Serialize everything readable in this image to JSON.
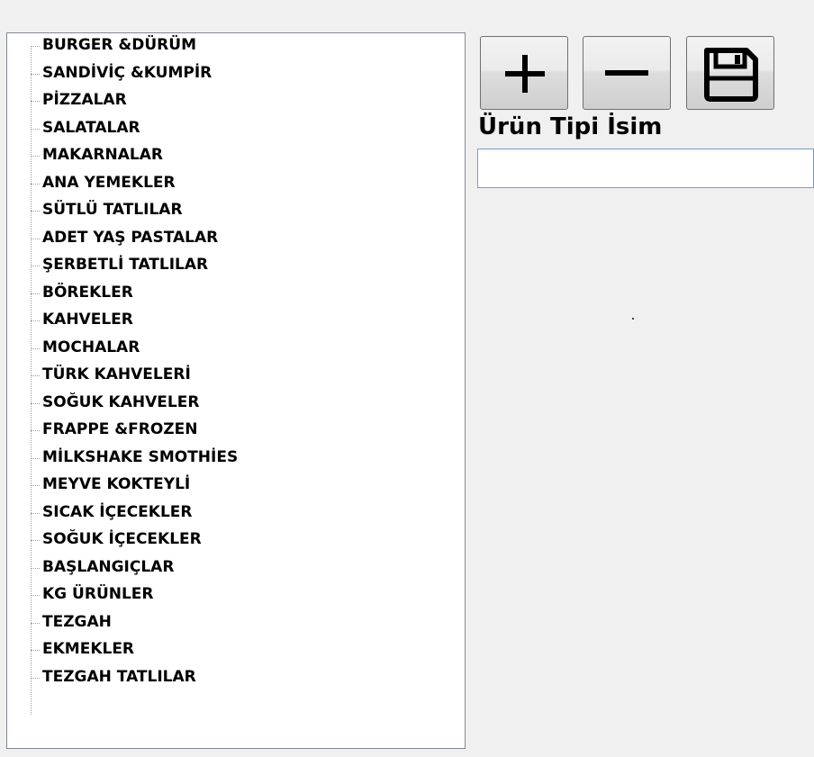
{
  "categories": {
    "items": [
      "BURGER &DÜRÜM",
      "SANDİVİÇ &KUMPİR",
      "PİZZALAR",
      "SALATALAR",
      "MAKARNALAR",
      "ANA YEMEKLER",
      "SÜTLÜ TATLILAR",
      "ADET YAŞ PASTALAR",
      "ŞERBETLİ TATLILAR",
      "BÖREKLER",
      "KAHVELER",
      "MOCHALAR",
      "TÜRK KAHVELERİ",
      "SOĞUK KAHVELER",
      "FRAPPE &FROZEN",
      "MİLKSHAKE SMOTHİES",
      "MEYVE KOKTEYLİ",
      "SICAK İÇECEKLER",
      "SOĞUK İÇECEKLER",
      "BAŞLANGIÇLAR",
      "KG ÜRÜNLER",
      "TEZGAH",
      "EKMEKLER",
      "TEZGAH TATLILAR"
    ]
  },
  "toolbar": {
    "add_icon": "plus-icon",
    "remove_icon": "minus-icon",
    "save_icon": "floppy-disk-icon"
  },
  "form": {
    "name_label": "Ürün Tipi İsim",
    "name_value": "",
    "name_placeholder": ""
  },
  "colors": {
    "window_background": "#f0f0f0",
    "tree_background": "#ffffff",
    "tree_border": "#828790",
    "input_border": "#7a9cc6",
    "icon_color": "#000000"
  }
}
